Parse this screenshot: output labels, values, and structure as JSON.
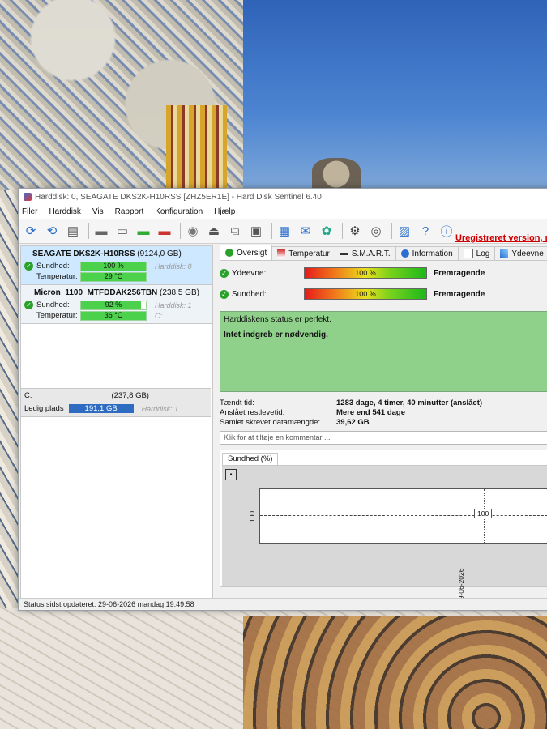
{
  "window": {
    "title": "Harddisk: 0, SEAGATE DKS2K-H10RSS [ZHZ5ER1E] - Hard Disk Sentinel 6.40"
  },
  "menu": [
    "Filer",
    "Harddisk",
    "Vis",
    "Rapport",
    "Konfiguration",
    "Hjælp"
  ],
  "toolbar": {
    "unregistered": "Uregistreret version, re"
  },
  "disks": [
    {
      "name": "SEAGATE DKS2K-H10RSS",
      "capacity": "(9124,0 GB)",
      "health_label": "Sundhed:",
      "health_value": "100 %",
      "health_pct": 100,
      "disk_ref": "Harddisk: 0",
      "temp_label": "Temperatur:",
      "temp_value": "29 °C",
      "temp_pct": 100,
      "temp_ref": ""
    },
    {
      "name": "Micron_1100_MTFDDAK256TBN",
      "capacity": "(238,5 GB)",
      "health_label": "Sundhed:",
      "health_value": "92 %",
      "health_pct": 92,
      "disk_ref": "Harddisk: 1",
      "temp_label": "Temperatur:",
      "temp_value": "36 °C",
      "temp_pct": 100,
      "temp_ref": "C:"
    }
  ],
  "volume": {
    "drive": "C:",
    "size": "(237,8 GB)",
    "free_label": "Ledig plads",
    "free_value": "191,1 GB",
    "disk_ref": "Harddisk: 1"
  },
  "tabs": [
    "Oversigt",
    "Temperatur",
    "S.M.A.R.T.",
    "Information",
    "Log",
    "Ydeevne"
  ],
  "overview": {
    "performance_label": "Ydeevne:",
    "performance_value": "100 %",
    "performance_word": "Fremragende",
    "health_label": "Sundhed:",
    "health_value": "100 %",
    "health_word": "Fremragende",
    "status_line1": "Harddiskens status er perfekt.",
    "status_line2": "Intet indgreb er nødvendig.",
    "info": [
      {
        "k": "Tændt tid:",
        "v": "1283 dage, 4 timer, 40 minutter (anslået)"
      },
      {
        "k": "Anslået restlevetid:",
        "v": "Mere end 541 dage"
      },
      {
        "k": "Samlet skrevet datamængde:",
        "v": "39,62 GB"
      }
    ],
    "comment_placeholder": "Klik for at tilføje en kommentar ..."
  },
  "graph": {
    "tab_label": "Sundhed (%)",
    "y_tick": "100",
    "point_label": "100",
    "x_tick": "29-06-2026"
  },
  "status_bar": "Status sidst opdateret: 29-06-2026 mandag 19:49:58"
}
